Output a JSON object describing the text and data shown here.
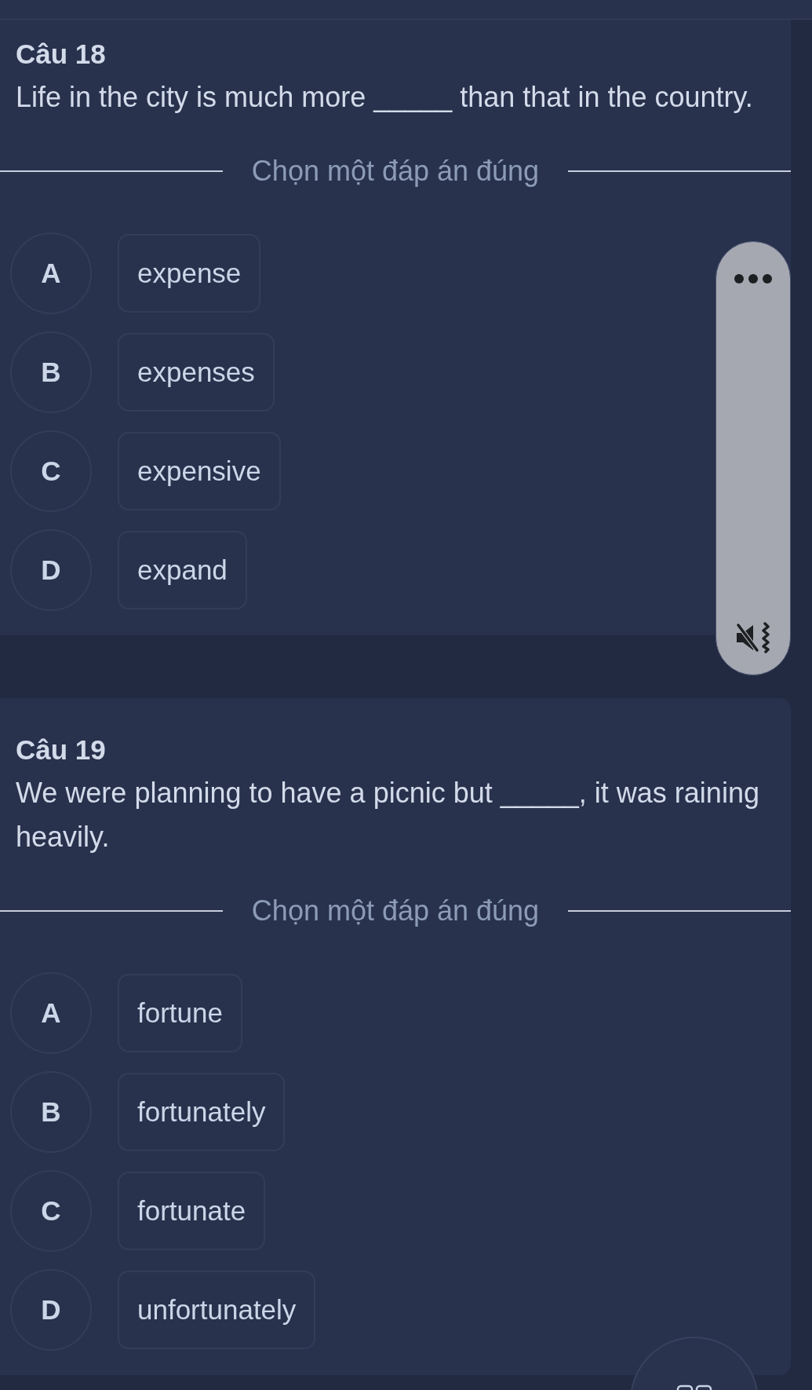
{
  "questions": [
    {
      "number": "Câu 18",
      "text": "Life in the city is much more _____ than that in the country.",
      "prompt": "Chọn một đáp án đúng",
      "options": [
        {
          "letter": "A",
          "text": "expense",
          "selected": false
        },
        {
          "letter": "B",
          "text": "expenses",
          "selected": false
        },
        {
          "letter": "C",
          "text": "expensive",
          "selected": false
        },
        {
          "letter": "D",
          "text": "expand",
          "selected": false
        }
      ]
    },
    {
      "number": "Câu 19",
      "text": "We were planning to have a picnic but _____, it was raining heavily.",
      "prompt": "Chọn một đáp án đúng",
      "options": [
        {
          "letter": "A",
          "text": "fortune",
          "selected": false
        },
        {
          "letter": "B",
          "text": "fortunately",
          "selected": false
        },
        {
          "letter": "C",
          "text": "fortunate",
          "selected": false
        },
        {
          "letter": "D",
          "text": "unfortunately",
          "selected": false
        }
      ]
    }
  ]
}
